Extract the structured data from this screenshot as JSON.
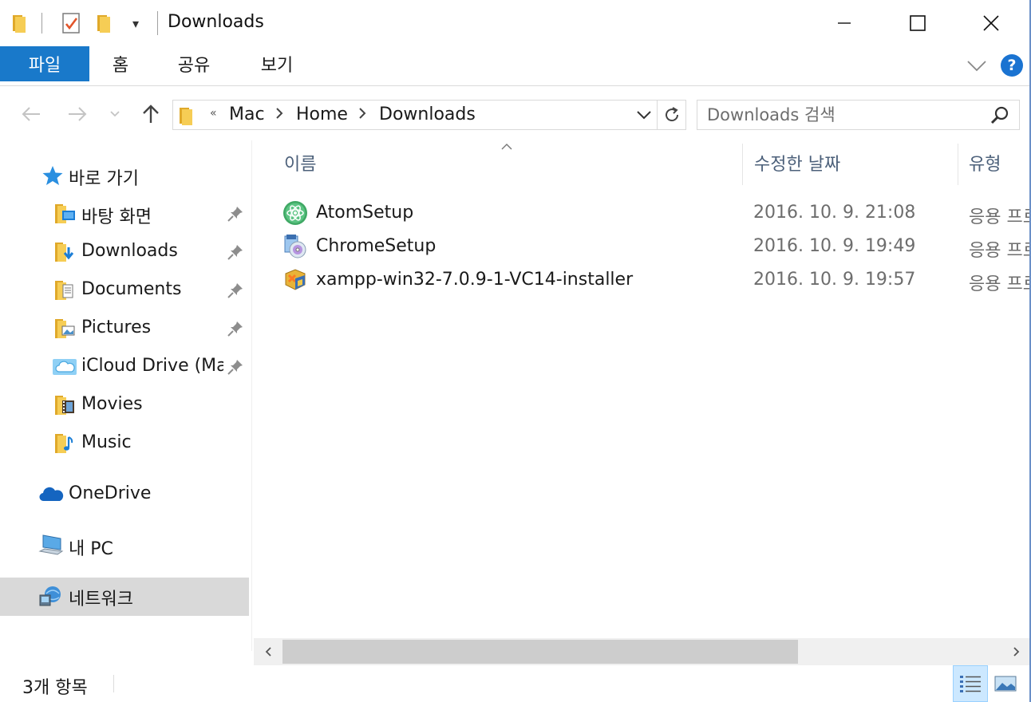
{
  "window": {
    "title": "Downloads",
    "quick_access_dropdown_glyph": "▾"
  },
  "ribbon": {
    "tabs": [
      {
        "label": "파일",
        "active": true
      },
      {
        "label": "홈"
      },
      {
        "label": "공유"
      },
      {
        "label": "보기"
      }
    ],
    "help_label": "?"
  },
  "address": {
    "overflow_glyph": "«",
    "crumbs": [
      "Mac",
      "Home",
      "Downloads"
    ],
    "separator": "›"
  },
  "search": {
    "placeholder": "Downloads 검색"
  },
  "nav": {
    "quick_access": "바로 가기",
    "pinned": [
      {
        "label": "바탕 화면",
        "icon": "desktop-folder-icon",
        "pinned": true
      },
      {
        "label": "Downloads",
        "icon": "downloads-folder-icon",
        "pinned": true
      },
      {
        "label": "Documents",
        "icon": "documents-folder-icon",
        "pinned": true
      },
      {
        "label": "Pictures",
        "icon": "pictures-folder-icon",
        "pinned": true
      },
      {
        "label": "iCloud Drive (Mac)",
        "icon": "icloud-folder-icon",
        "pinned": true
      },
      {
        "label": "Movies",
        "icon": "movies-folder-icon",
        "pinned": false
      },
      {
        "label": "Music",
        "icon": "music-folder-icon",
        "pinned": false
      }
    ],
    "onedrive": "OneDrive",
    "this_pc": "내 PC",
    "network": "네트워크"
  },
  "columns": {
    "name": "이름",
    "modified": "수정한 날짜",
    "type": "유형"
  },
  "files": [
    {
      "name": "AtomSetup",
      "modified": "2016. 10. 9. 21:08",
      "type": "응용 프로그램",
      "icon": "atom-icon"
    },
    {
      "name": "ChromeSetup",
      "modified": "2016. 10. 9. 19:49",
      "type": "응용 프로그램",
      "icon": "installer-cd-icon"
    },
    {
      "name": "xampp-win32-7.0.9-1-VC14-installer",
      "modified": "2016. 10. 9. 19:57",
      "type": "응용 프로그램",
      "icon": "xampp-installer-icon"
    }
  ],
  "status": {
    "item_count": "3개 항목"
  },
  "colors": {
    "accent": "#1979ca",
    "header_text": "#4c607a",
    "selected_nav": "#d9d9d9",
    "folder_yellow": "#f3c74e"
  }
}
